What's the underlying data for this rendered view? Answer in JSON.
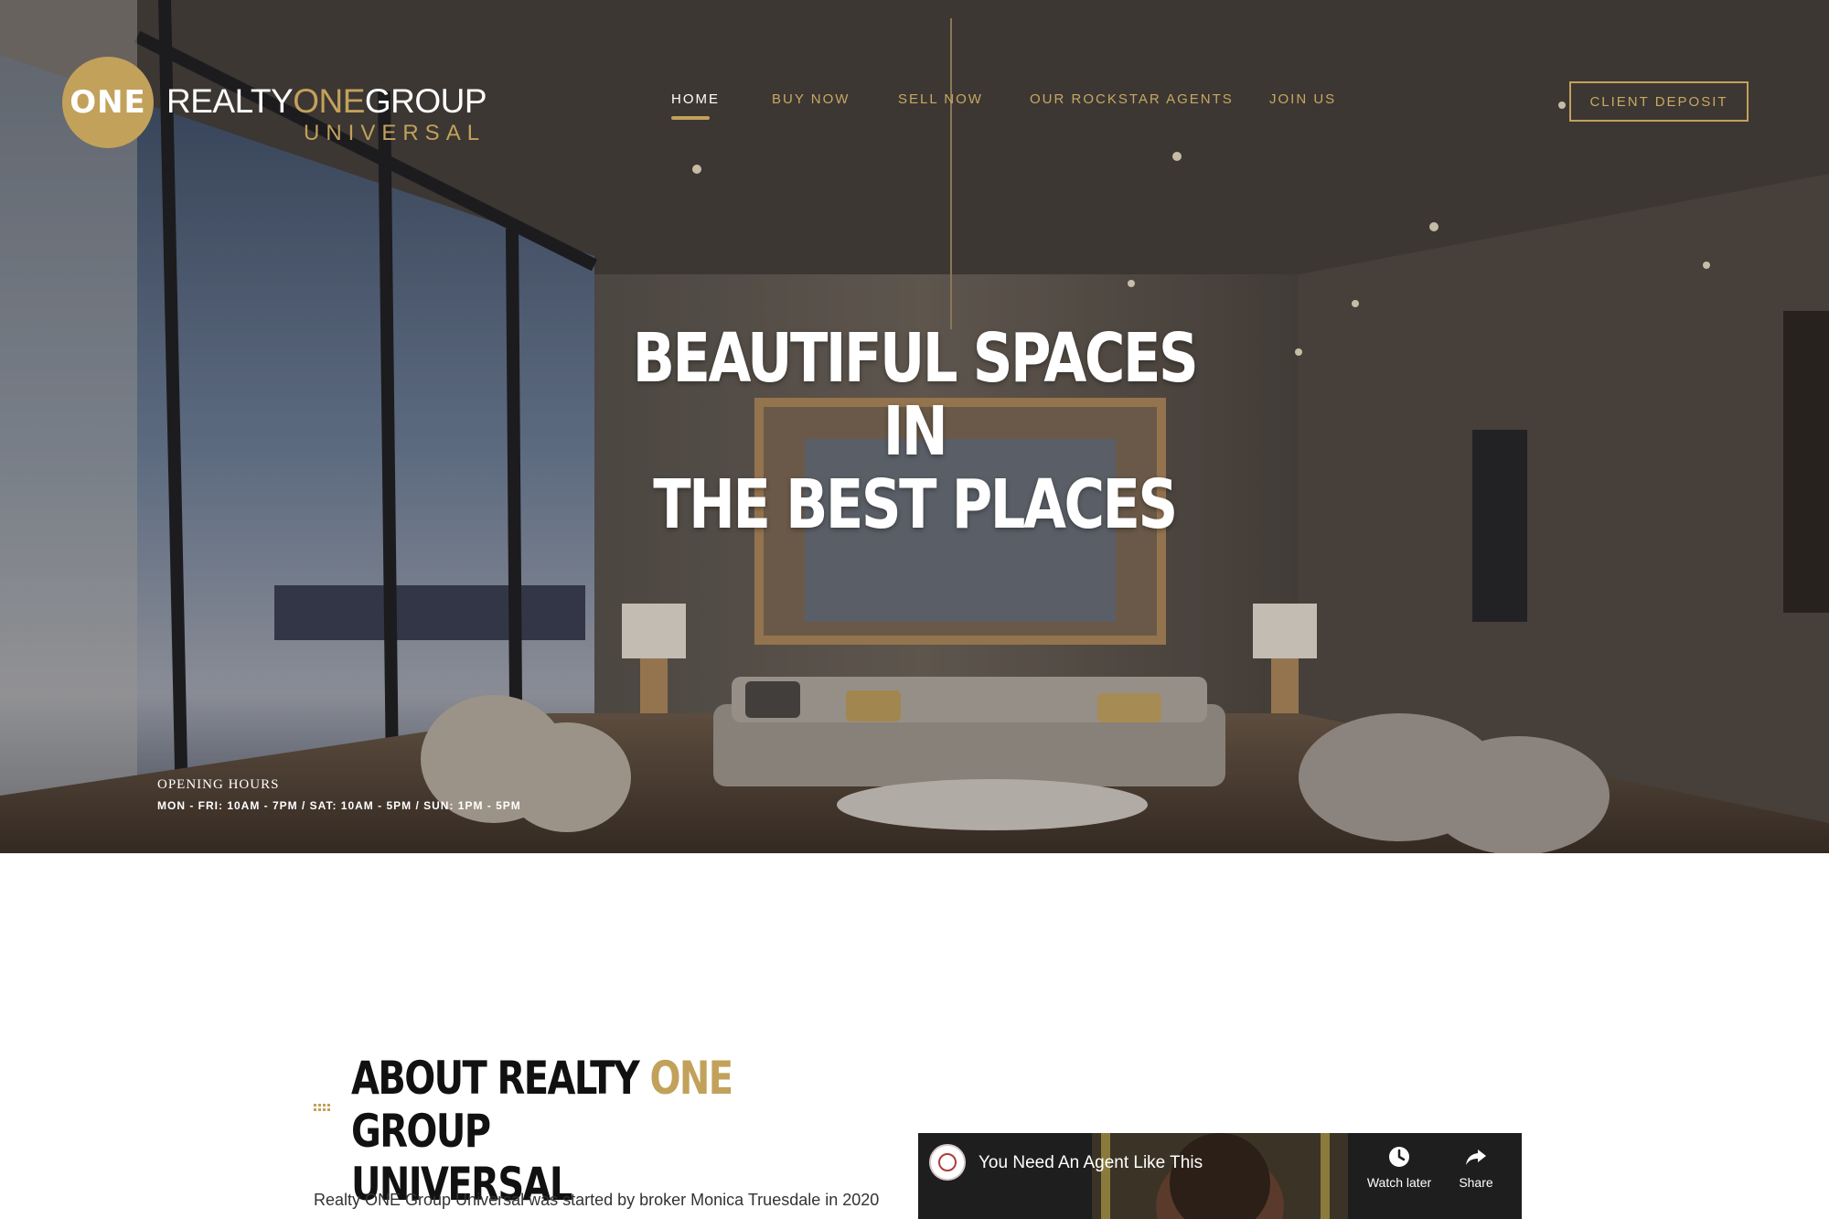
{
  "brand": {
    "logo_mark": "ONE",
    "name_part1": "REALTY",
    "name_part2": "ONE",
    "name_part3": "GROUP",
    "name_sub": "UNIVERSAL",
    "accent_color": "#c2a15b"
  },
  "nav": {
    "items": [
      {
        "label": "HOME",
        "active": true
      },
      {
        "label": "BUY NOW",
        "active": false
      },
      {
        "label": "SELL NOW",
        "active": false
      },
      {
        "label": "OUR ROCKSTAR AGENTS",
        "active": false
      },
      {
        "label": "JOIN US",
        "active": false
      }
    ],
    "cta_label": "CLIENT DEPOSIT"
  },
  "hero": {
    "headline_line1": "BEAUTIFUL SPACES IN",
    "headline_line2": "THE BEST PLACES",
    "hours_title": "OPENING HOURS",
    "hours_times": "MON - FRI: 10AM - 7PM / SAT: 10AM - 5PM / SUN: 1PM - 5PM"
  },
  "about": {
    "title_part1": "ABOUT REALTY ",
    "title_part2": "ONE",
    "title_part3": " GROUP",
    "title_line2": "UNIVERSAL",
    "body": "Realty ONE Group Universal was started by broker Monica Truesdale in 2020"
  },
  "video": {
    "title": "You Need An Agent Like This",
    "watch_later": "Watch later",
    "share": "Share",
    "channel_icon": "channel-logo-icon"
  }
}
